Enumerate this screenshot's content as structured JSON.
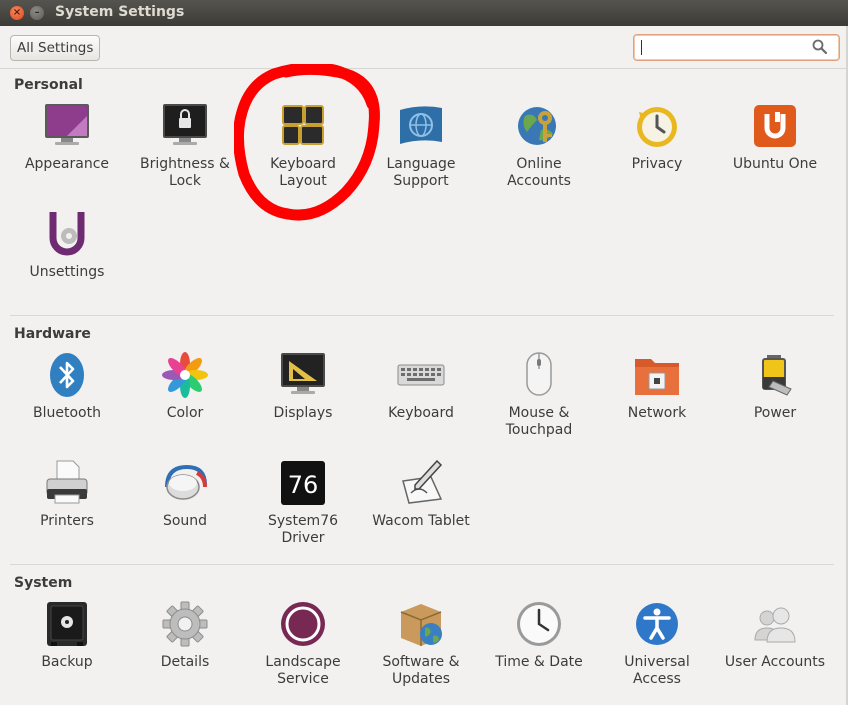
{
  "window": {
    "title": "System Settings"
  },
  "toolbar": {
    "all_settings": "All Settings",
    "search_placeholder": ""
  },
  "sections": {
    "personal": {
      "header": "Personal",
      "items": [
        {
          "label1": "Appearance",
          "label2": "",
          "icon": "appearance-icon"
        },
        {
          "label1": "Brightness &",
          "label2": "Lock",
          "icon": "brightness-lock-icon"
        },
        {
          "label1": "Keyboard",
          "label2": "Layout",
          "icon": "keyboard-layout-icon"
        },
        {
          "label1": "Language",
          "label2": "Support",
          "icon": "language-support-icon"
        },
        {
          "label1": "Online",
          "label2": "Accounts",
          "icon": "online-accounts-icon"
        },
        {
          "label1": "Privacy",
          "label2": "",
          "icon": "privacy-icon"
        },
        {
          "label1": "Ubuntu One",
          "label2": "",
          "icon": "ubuntu-one-icon"
        },
        {
          "label1": "Unsettings",
          "label2": "",
          "icon": "unsettings-icon"
        }
      ]
    },
    "hardware": {
      "header": "Hardware",
      "items": [
        {
          "label1": "Bluetooth",
          "label2": "",
          "icon": "bluetooth-icon"
        },
        {
          "label1": "Color",
          "label2": "",
          "icon": "color-icon"
        },
        {
          "label1": "Displays",
          "label2": "",
          "icon": "displays-icon"
        },
        {
          "label1": "Keyboard",
          "label2": "",
          "icon": "keyboard-icon"
        },
        {
          "label1": "Mouse &",
          "label2": "Touchpad",
          "icon": "mouse-icon"
        },
        {
          "label1": "Network",
          "label2": "",
          "icon": "network-icon"
        },
        {
          "label1": "Power",
          "label2": "",
          "icon": "power-icon"
        },
        {
          "label1": "Printers",
          "label2": "",
          "icon": "printer-icon"
        },
        {
          "label1": "Sound",
          "label2": "",
          "icon": "sound-icon"
        },
        {
          "label1": "System76",
          "label2": "Driver",
          "icon": "system76-icon",
          "icon_text": "76"
        },
        {
          "label1": "Wacom Tablet",
          "label2": "",
          "icon": "wacom-tablet-icon"
        }
      ]
    },
    "system": {
      "header": "System",
      "items": [
        {
          "label1": "Backup",
          "label2": "",
          "icon": "backup-icon"
        },
        {
          "label1": "Details",
          "label2": "",
          "icon": "details-icon"
        },
        {
          "label1": "Landscape",
          "label2": "Service",
          "icon": "landscape-icon"
        },
        {
          "label1": "Software &",
          "label2": "Updates",
          "icon": "software-updates-icon"
        },
        {
          "label1": "Time & Date",
          "label2": "",
          "icon": "time-date-icon"
        },
        {
          "label1": "Universal",
          "label2": "Access",
          "icon": "universal-access-icon"
        },
        {
          "label1": "User Accounts",
          "label2": "",
          "icon": "user-accounts-icon"
        }
      ]
    }
  },
  "annotation": {
    "color": "#ff0000",
    "target": "Keyboard Layout"
  },
  "colors": {
    "accent": "#dd4814",
    "titlebar": "#3c3b37",
    "background": "#f2f1f0"
  }
}
